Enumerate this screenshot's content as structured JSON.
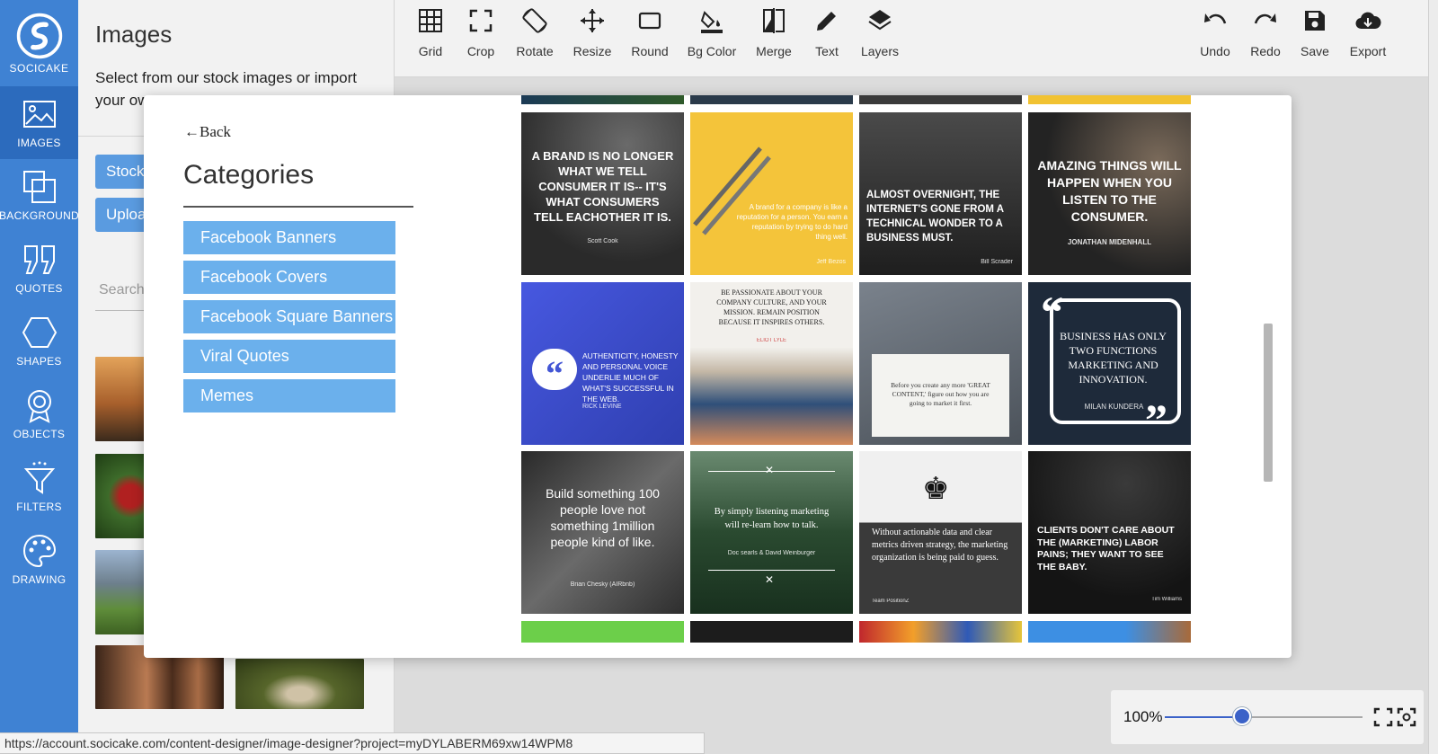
{
  "brand": {
    "name": "SOCICAKE"
  },
  "rail": {
    "items": [
      {
        "label": "IMAGES",
        "icon": "image-icon",
        "active": true
      },
      {
        "label": "BACKGROUND",
        "icon": "background-icon"
      },
      {
        "label": "QUOTES",
        "icon": "quotes-icon"
      },
      {
        "label": "SHAPES",
        "icon": "hexagon-icon"
      },
      {
        "label": "OBJECTS",
        "icon": "badge-icon"
      },
      {
        "label": "FILTERS",
        "icon": "filter-icon"
      },
      {
        "label": "DRAWING",
        "icon": "palette-icon"
      }
    ]
  },
  "panel": {
    "title": "Images",
    "description": "Select from our stock images or import your ow",
    "stock_button": "Stock",
    "upload_button": "Uploa",
    "search_placeholder": "Search"
  },
  "toolbar": {
    "tools": [
      {
        "label": "Grid",
        "icon": "grid-icon"
      },
      {
        "label": "Crop",
        "icon": "crop-icon"
      },
      {
        "label": "Rotate",
        "icon": "rotate-icon"
      },
      {
        "label": "Resize",
        "icon": "resize-icon"
      },
      {
        "label": "Round",
        "icon": "round-icon"
      },
      {
        "label": "Bg Color",
        "icon": "paint-bucket-icon"
      },
      {
        "label": "Merge",
        "icon": "merge-icon"
      },
      {
        "label": "Text",
        "icon": "pencil-icon"
      },
      {
        "label": "Layers",
        "icon": "layers-icon"
      }
    ],
    "actions": [
      {
        "label": "Undo",
        "icon": "undo-icon"
      },
      {
        "label": "Redo",
        "icon": "redo-icon"
      },
      {
        "label": "Save",
        "icon": "save-icon"
      },
      {
        "label": "Export",
        "icon": "cloud-download-icon"
      }
    ]
  },
  "modal": {
    "back_label": "Back",
    "categories_title": "Categories",
    "categories": [
      "Facebook Banners",
      "Facebook Covers",
      "Facebook Square Banners",
      "Viral Quotes",
      "Memes"
    ],
    "tiles": [
      {
        "quote": "A BRAND IS NO LONGER WHAT WE TELL CONSUMER IT IS-- IT'S WHAT CONSUMERS TELL EACHOTHER IT IS.",
        "author": "Scott Cook",
        "bg": "#3a3a3a"
      },
      {
        "quote": "A brand for a company is like a reputation for a person. You earn a reputation by trying to do hard thing well.",
        "author": "Jeff Bezos",
        "bg": "#f4c43a"
      },
      {
        "quote": "ALMOST OVERNIGHT, THE INTERNET'S GONE FROM A TECHNICAL WONDER TO A BUSINESS MUST.",
        "author": "Bill Scrader",
        "bg": "#2b2b2b"
      },
      {
        "quote": "AMAZING THINGS WILL HAPPEN WHEN YOU LISTEN TO THE CONSUMER.",
        "author": "JONATHAN MIDENHALL",
        "bg": "#262626"
      },
      {
        "quote": "AUTHENTICITY, HONESTY AND PERSONAL VOICE UNDERLIE MUCH OF WHAT'S SUCCESSFUL IN THE WEB.",
        "author": "RICK LEVINE",
        "bg": "#3f4fd0"
      },
      {
        "quote": "BE PASSIONATE ABOUT YOUR COMPANY CULTURE, AND YOUR MISSION. REMAIN POSITION BECAUSE IT INSPIRES OTHERS.",
        "author": "ELIOT LYLE",
        "bg": "#e9e6e0"
      },
      {
        "quote": "Before you create any more 'GREAT CONTENT,' figure out how you are going to market it first.",
        "author": "",
        "bg": "#5f6670"
      },
      {
        "quote": "BUSINESS HAS ONLY TWO FUNCTIONS MARKETING AND INNOVATION.",
        "author": "MILAN KUNDERA",
        "bg": "#1e2a3a"
      },
      {
        "quote": "Build something 100 people love not something 1million people kind of like.",
        "author": "Brian Chesky (AIRbnb)",
        "bg": "#4a4a4a"
      },
      {
        "quote": "By simply listening marketing will re-learn how to talk.",
        "author": "Doc searls & David Weinburger",
        "bg": "#2f4a32"
      },
      {
        "quote": "Without actionable data and clear metrics driven strategy, the marketing organization is being paid to guess.",
        "author": "Team PositionZ",
        "bg": "#3c3c3c"
      },
      {
        "quote": "CLIENTS DON'T CARE ABOUT THE (MARKETING) LABOR PAINS; THEY WANT TO SEE THE BABY.",
        "author": "Tim Williams",
        "bg": "#1a1a1a"
      }
    ]
  },
  "zoom": {
    "label": "100%",
    "level": 0.39
  },
  "status_url": "https://account.socicake.com/content-designer/image-designer?project=myDYLABERM69xw14WPM8",
  "colors": {
    "rail": "#3f82d3",
    "rail_active": "#2c6bbd",
    "category": "#6bb0ec",
    "accent": "#3b62c8"
  }
}
